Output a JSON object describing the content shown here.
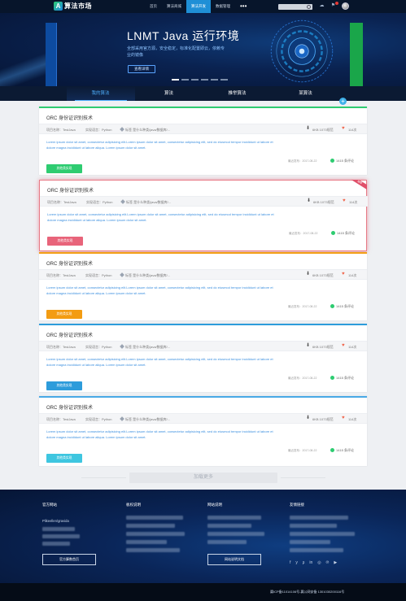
{
  "nav": {
    "logo_text": "算法市场",
    "items": [
      "首页",
      "算法商城",
      "算法开发",
      "数据管理"
    ],
    "active_index": 2,
    "more": "•••",
    "search_placeholder": ""
  },
  "banner": {
    "title": "LNMT Java 运行环境",
    "subtitle": "全部采用官方源，安全稳定，标准化配置即云，依赖专业的镜像",
    "button": "查看详情",
    "slides": 6,
    "active_slide": 0
  },
  "tabs": [
    "我的算法",
    "算法",
    "推举算法",
    "某算法"
  ],
  "tabs_active": 0,
  "cards": [
    {
      "title": "ORC 身份证识别技术",
      "project_name": "项目名称：TestJava",
      "lang": "实现语言：Python",
      "tags": "标签 是什么种类/java/数据库/...",
      "downloads": "6KB  1073规范",
      "likes": "114次",
      "desc": "Lorem ipsum dolor sit amet, consectetur adipisicing elit.Lorem ipsum dolor sit amet, consectetur adipisicing elit, sed do eiusmod tempor incididunt ut labore et dolore magna incididunt ut labore aliqua. Lorem ipsum dolor sit amet.",
      "date": "最近发布：2017-08-22",
      "comments": "1415 条评论",
      "button": "其他类实现",
      "accent": "#2ecc71",
      "ribbon": ""
    },
    {
      "title": "ORC 身份证识别技术",
      "project_name": "项目名称：TestJava",
      "lang": "实现语言：Python",
      "tags": "标签 是什么种类/java/数据库/...",
      "downloads": "6KB  1073规范",
      "likes": "114次",
      "desc": "Lorem ipsum dolor sit amet, consectetur adipisicing elit.Lorem ipsum dolor sit amet, consectetur adipisicing elit, sed do eiusmod tempor incididunt ut labore et dolore magna incididunt ut labore aliqua. Lorem ipsum dolor sit amet.",
      "date": "最近发布：2017-08-22",
      "comments": "1415 条评论",
      "button": "其他类实现",
      "accent": "#e8647a",
      "ribbon": "推荐"
    },
    {
      "title": "ORC 身份证识别技术",
      "project_name": "项目名称：TestJava",
      "lang": "实现语言：Python",
      "tags": "标签 是什么种类/java/数据库/...",
      "downloads": "6KB  1073规范",
      "likes": "114次",
      "desc": "Lorem ipsum dolor sit amet, consectetur adipisicing elit.Lorem ipsum dolor sit amet, consectetur adipisicing elit, sed do eiusmod tempor incididunt ut labore et dolore magna incididunt ut labore aliqua. Lorem ipsum dolor sit amet.",
      "date": "最近发布：2017-08-22",
      "comments": "1415 条评论",
      "button": "其他类实现",
      "accent": "#f39c12",
      "ribbon": ""
    },
    {
      "title": "ORC 身份证识别技术",
      "project_name": "项目名称：TestJava",
      "lang": "实现语言：Python",
      "tags": "标签 是什么种类/java/数据库/...",
      "downloads": "6KB  1073规范",
      "likes": "114次",
      "desc": "Lorem ipsum dolor sit amet, consectetur adipisicing elit.Lorem ipsum dolor sit amet, consectetur adipisicing elit, sed do eiusmod tempor incididunt ut labore et dolore magna incididunt ut labore aliqua. Lorem ipsum dolor sit amet.",
      "date": "最近发布：2017-08-22",
      "comments": "1415 条评论",
      "button": "其他类实现",
      "accent": "#2d9cdb",
      "ribbon": ""
    },
    {
      "title": "ORC 身份证识别技术",
      "project_name": "项目名称：TestJava",
      "lang": "实现语言：Python",
      "tags": "标签 是什么种类/java/数据库/...",
      "downloads": "6KB  1073规范",
      "likes": "114次",
      "desc": "Lorem ipsum dolor sit amet, consectetur adipisicing elit.Lorem ipsum dolor sit amet, consectetur adipisicing elit, sed do eiusmod tempor incididunt ut labore et dolore magna incididunt ut labore aliqua. Lorem ipsum dolor sit amet.",
      "date": "最近发布：2017-08-22",
      "comments": "1415 条评论",
      "button": "其他类实现",
      "accent": "#3ec6e0",
      "ribbon": ""
    }
  ],
  "load_more": "加载更多",
  "footer": {
    "col1_title": "官方网站",
    "col1_line": "Plikeellen/gravida",
    "col1_button": "官方算数首页",
    "col2_title": "板权说明",
    "col3_title": "网站说明",
    "col3_button": "网站说明文档",
    "col4_title": "友情链接",
    "social": [
      "f",
      "y",
      "ʂ",
      "in",
      "◎",
      "℗",
      "▶"
    ],
    "copyright": "冀ICP备11014106号-冀公网安备 1301030200116号"
  },
  "colors": {
    "nav_bg": "#07152b",
    "accent": "#1f8fd6",
    "footer_bg": "#0a2558"
  }
}
